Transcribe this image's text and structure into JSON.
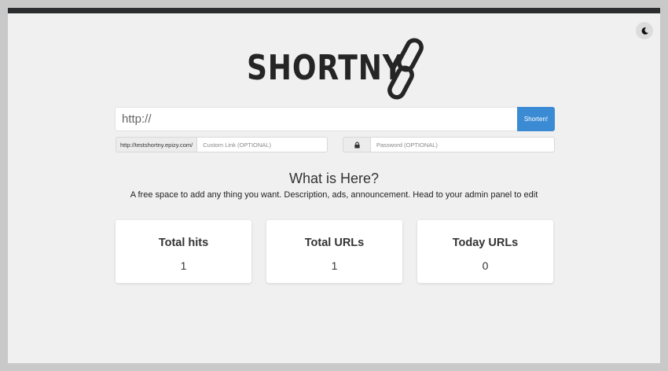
{
  "header": {
    "logo_text": "SHORTNY",
    "theme_toggle_icon": "moon-icon"
  },
  "shorten_form": {
    "url_placeholder": "http://",
    "submit_label": "Shorten!",
    "domain_prefix": "http://testshortny.epizy.com/",
    "custom_link_placeholder": "Custom Link (OPTIONAL)",
    "password_icon": "lock-icon",
    "password_placeholder": "Password (OPTIONAL)"
  },
  "info": {
    "title": "What is Here?",
    "description": "A free space to add any thing you want. Description, ads, announcement. Head to your admin panel to edit"
  },
  "stats": [
    {
      "label": "Total hits",
      "value": "1"
    },
    {
      "label": "Total URLs",
      "value": "1"
    },
    {
      "label": "Today URLs",
      "value": "0"
    }
  ],
  "colors": {
    "accent": "#3b8bd4",
    "page_background": "#f0f0f0",
    "top_bar": "#2b2d2f"
  }
}
